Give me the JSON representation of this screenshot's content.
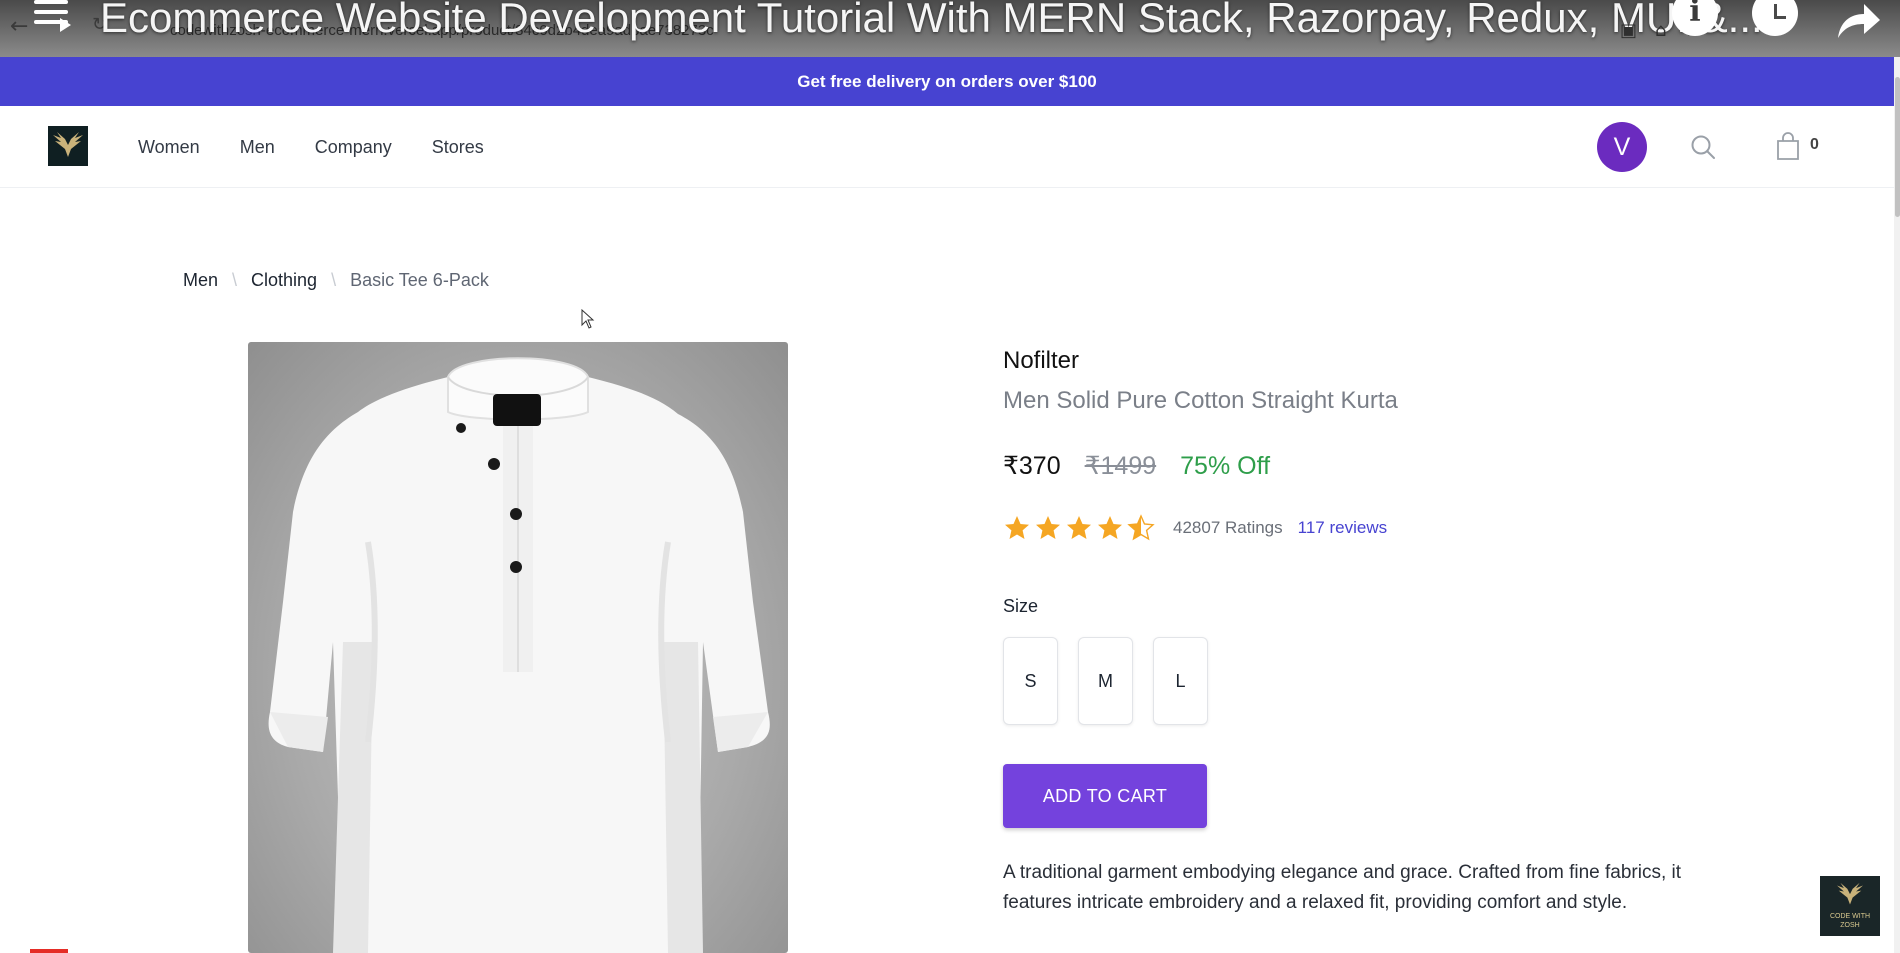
{
  "video_overlay": {
    "title": "Ecommerce Website Development Tutorial With MERN Stack, Razorpay, Redux, MUI &...",
    "info_glyph": "i"
  },
  "browser": {
    "url": "codewithzosh-ecommerce-mern.vercel.app/product/84c0d2b4dea9adbae738273c"
  },
  "promo_bar": {
    "text": "Get free delivery on orders over $100",
    "color": "#4743d1"
  },
  "header": {
    "nav_items": [
      "Women",
      "Men",
      "Company",
      "Stores"
    ],
    "avatar_letter": "V",
    "avatar_color": "#6b2bbf",
    "cart_count": "0",
    "icons": [
      "search-icon",
      "shopping-bag-icon"
    ]
  },
  "breadcrumb": {
    "items": [
      "Men",
      "Clothing"
    ],
    "current": "Basic Tee 6-Pack"
  },
  "product": {
    "brand": "Nofilter",
    "title": "Men Solid Pure Cotton Straight Kurta",
    "price": "₹370",
    "original_price": "₹1499",
    "discount": "75% Off",
    "discount_color": "#2e9e4a",
    "rating_value": 4.5,
    "rating_max": 5,
    "ratings_count": "42807 Ratings",
    "reviews_link": "117 reviews",
    "size_label": "Size",
    "sizes": [
      "S",
      "M",
      "L"
    ],
    "add_to_cart_label": "ADD TO CART",
    "add_to_cart_color": "#7442dd",
    "description": "A traditional garment embodying elegance and grace. Crafted from fine fabrics, it features intricate embroidery and a relaxed fit, providing comfort and style."
  },
  "watermark": {
    "text": "CODE WITH ZOSH"
  }
}
